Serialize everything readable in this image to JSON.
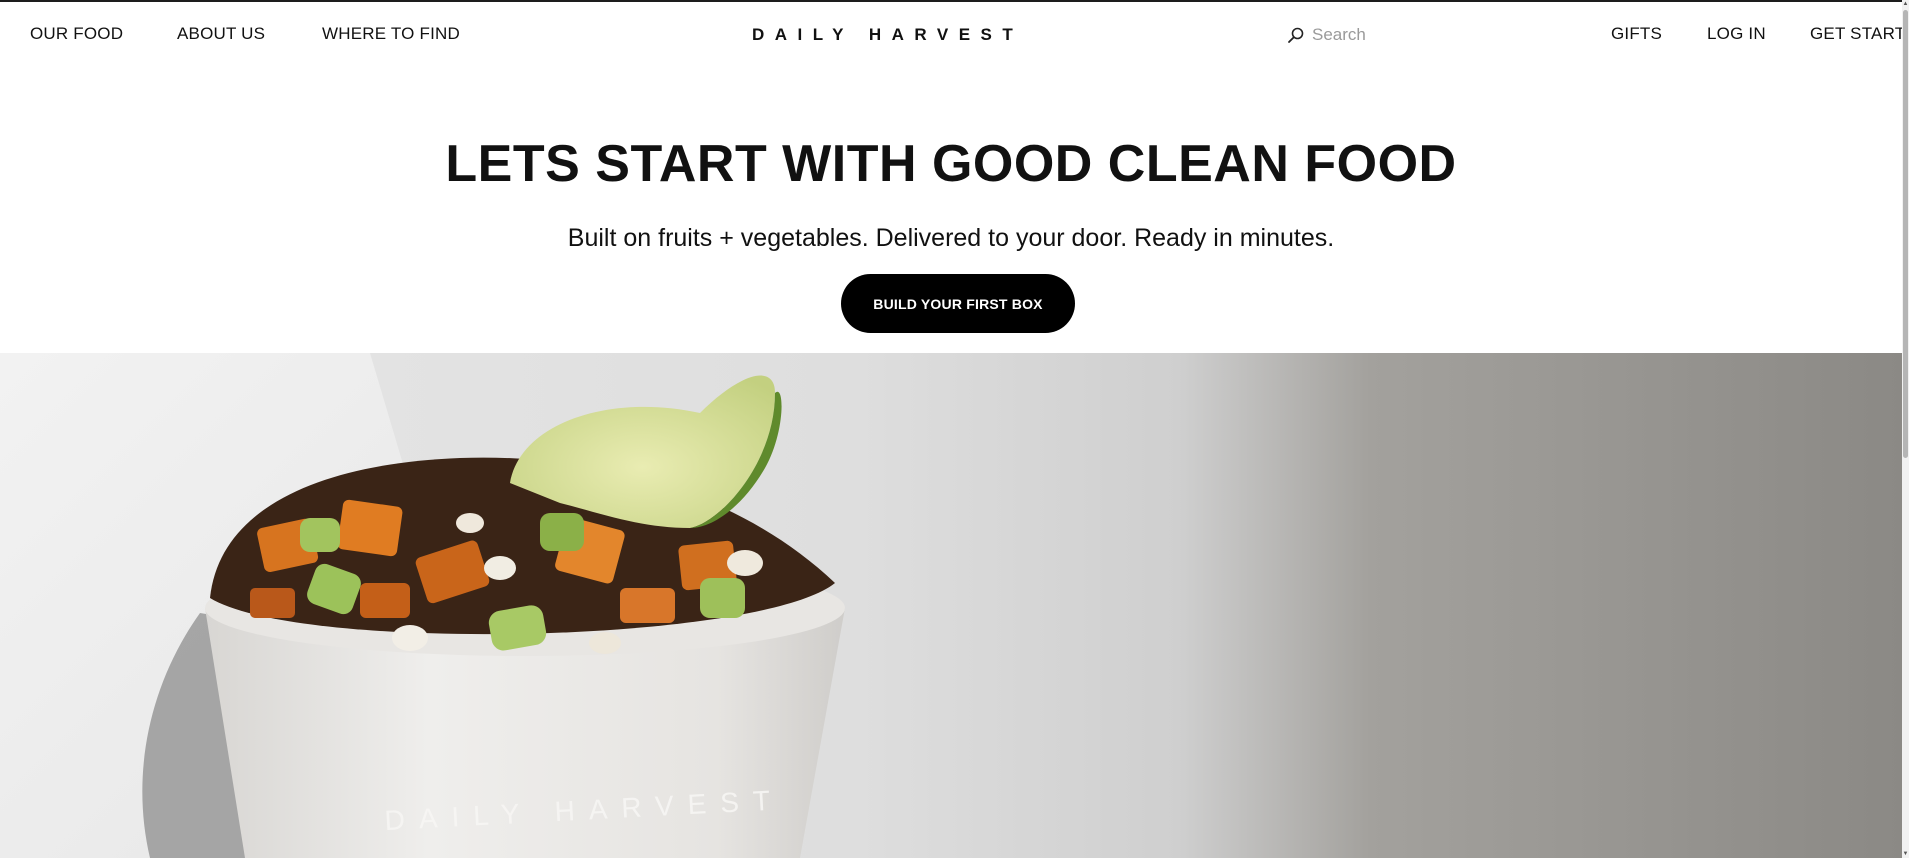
{
  "header": {
    "nav_left": [
      {
        "label": "OUR FOOD"
      },
      {
        "label": "ABOUT US"
      },
      {
        "label": "WHERE TO FIND"
      }
    ],
    "logo": "DAILY HARVEST",
    "search": {
      "placeholder": "Search",
      "icon": "search-icon"
    },
    "nav_right": [
      {
        "label": "GIFTS"
      },
      {
        "label": "LOG IN"
      },
      {
        "label": "GET STARTE"
      }
    ]
  },
  "hero": {
    "title": "LETS START WITH GOOD CLEAN FOOD",
    "subtitle": "Built on fruits + vegetables. Delivered to your door. Ready in minutes.",
    "cta_label": "BUILD YOUR FIRST BOX",
    "image_cup_text": "DAILY HARVEST"
  },
  "colors": {
    "text": "#111111",
    "cta_background": "#000000",
    "cta_text": "#ffffff",
    "placeholder": "#9a9a9a"
  }
}
